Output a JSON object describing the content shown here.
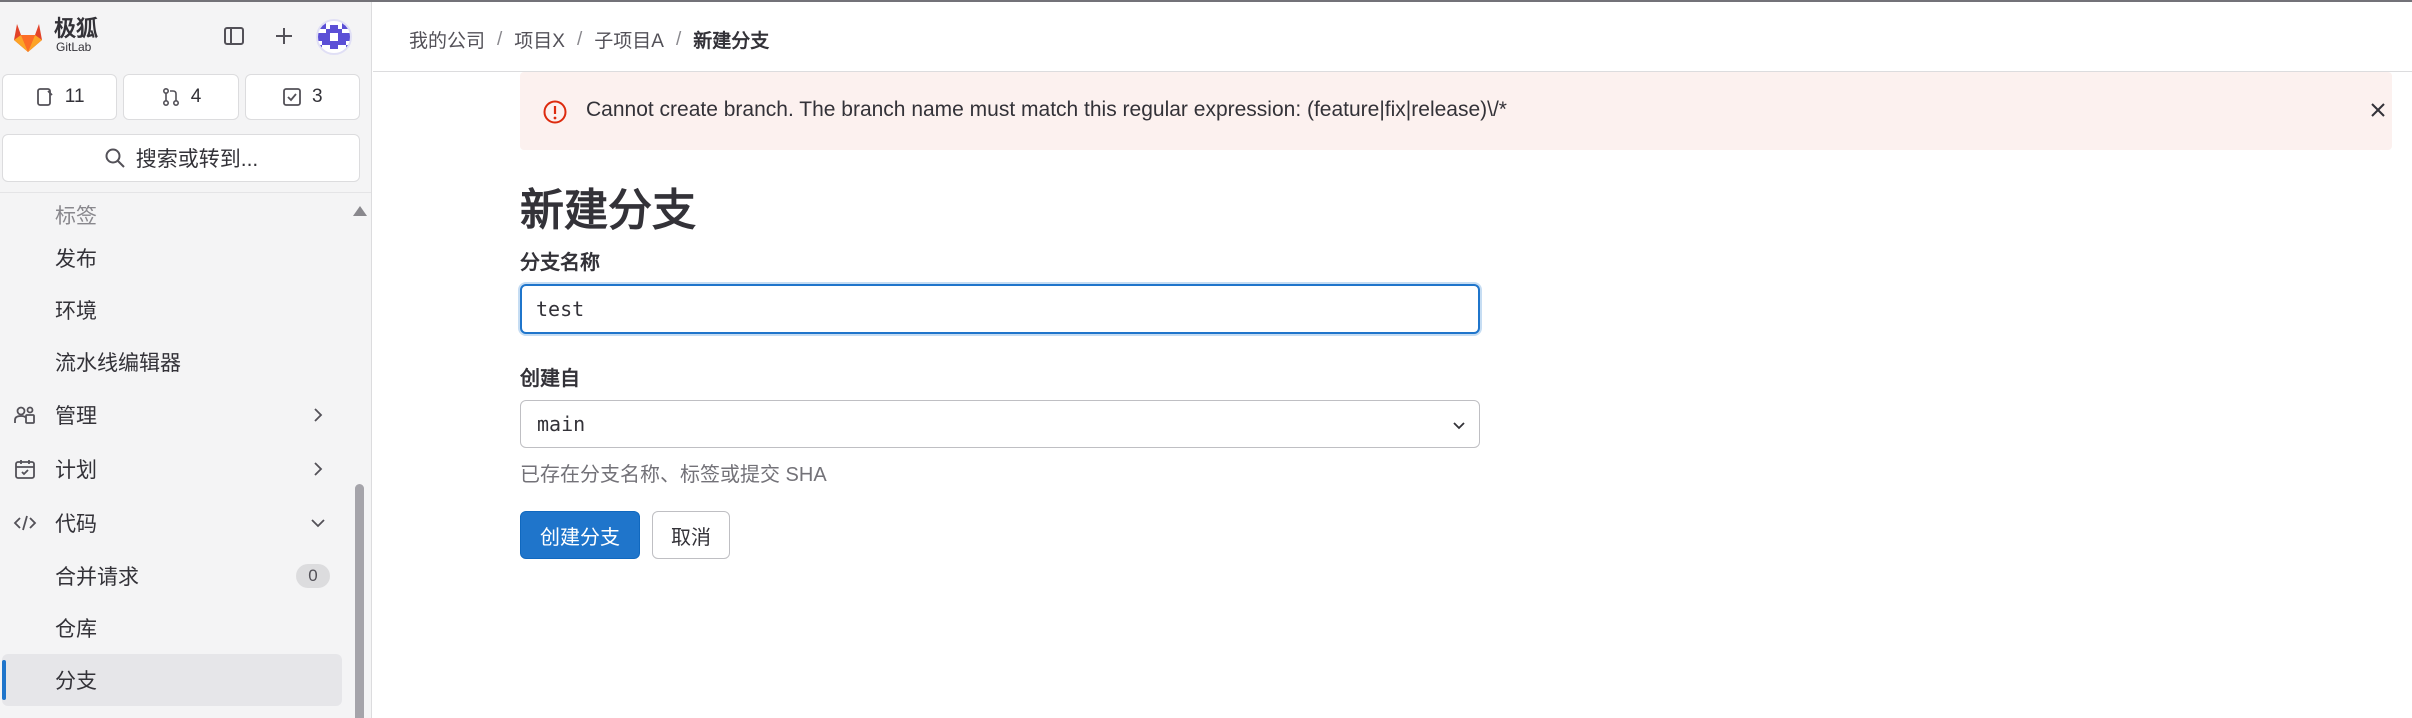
{
  "brand": {
    "name_cn": "极狐",
    "name_en": "GitLab"
  },
  "counters": [
    {
      "icon": "issues-icon",
      "count": "11"
    },
    {
      "icon": "merge-request-icon",
      "count": "4"
    },
    {
      "icon": "todo-icon",
      "count": "3"
    }
  ],
  "search": {
    "label": "搜索或转到..."
  },
  "sidebar": {
    "items": [
      {
        "label": "标签"
      },
      {
        "label": "发布"
      },
      {
        "label": "环境"
      },
      {
        "label": "流水线编辑器"
      },
      {
        "label": "管理"
      },
      {
        "label": "计划"
      },
      {
        "label": "代码"
      },
      {
        "label": "合并请求",
        "badge": "0"
      },
      {
        "label": "仓库"
      },
      {
        "label": "分支"
      }
    ]
  },
  "breadcrumb": [
    "我的公司",
    "项目X",
    "子项目A",
    "新建分支"
  ],
  "alert": {
    "message": "Cannot create branch. The branch name must match this regular expression: (feature|fix|release)\\/*"
  },
  "form": {
    "title": "新建分支",
    "branch_name_label": "分支名称",
    "branch_name_value": "test",
    "create_from_label": "创建自",
    "create_from_value": "main",
    "help_text": "已存在分支名称、标签或提交 SHA",
    "submit_label": "创建分支",
    "cancel_label": "取消"
  },
  "colors": {
    "accent": "#1f75cb",
    "alert_bg": "#fcf1ef",
    "danger": "#dd2b0e"
  }
}
